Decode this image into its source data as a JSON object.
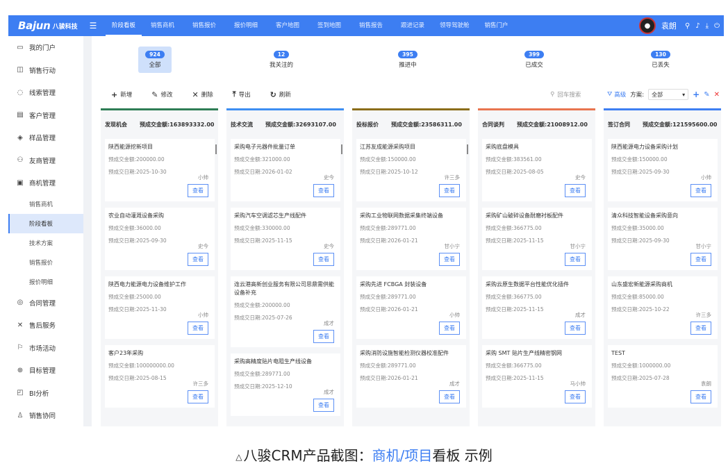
{
  "topbar": {
    "logo": "Bajun",
    "logo_cn": "八骏科技",
    "navs": [
      "阶段看板",
      "销售商机",
      "销售报价",
      "报价明细",
      "客户地图",
      "签到地图",
      "销售报告",
      "跟进记录",
      "领导驾驶舱",
      "销售门户"
    ],
    "active_nav": 0,
    "user": "袁朗"
  },
  "sidebar": {
    "items": [
      {
        "icon": "▭",
        "label": "我的门户"
      },
      {
        "icon": "◫",
        "label": "销售行动"
      },
      {
        "icon": "◌",
        "label": "线索管理"
      },
      {
        "icon": "▤",
        "label": "客户管理"
      },
      {
        "icon": "◈",
        "label": "样品管理"
      },
      {
        "icon": "⚇",
        "label": "友商管理"
      },
      {
        "icon": "▣",
        "label": "商机管理"
      }
    ],
    "subitems": [
      "销售商机",
      "阶段看板",
      "技术方案",
      "销售报价",
      "报价明细"
    ],
    "active_sub": 1,
    "items2": [
      {
        "icon": "◎",
        "label": "合同管理"
      },
      {
        "icon": "✕",
        "label": "售后服务"
      },
      {
        "icon": "⚐",
        "label": "市场活动"
      },
      {
        "icon": "⊕",
        "label": "目标管理"
      },
      {
        "icon": "◰",
        "label": "BI分析"
      },
      {
        "icon": "♙",
        "label": "销售协同"
      }
    ]
  },
  "stats": [
    {
      "count": "924",
      "label": "全部"
    },
    {
      "count": "12",
      "label": "我关注的"
    },
    {
      "count": "395",
      "label": "推进中"
    },
    {
      "count": "399",
      "label": "已成交"
    },
    {
      "count": "130",
      "label": "已丢失"
    }
  ],
  "toolbar": {
    "buttons": [
      {
        "icon": "+",
        "label": "新增"
      },
      {
        "icon": "✎",
        "label": "修改"
      },
      {
        "icon": "✕",
        "label": "删除"
      },
      {
        "icon": "⤒",
        "label": "导出"
      },
      {
        "icon": "↻",
        "label": "刷新"
      }
    ],
    "search_placeholder": "回车搜索",
    "advanced": "高级",
    "scheme_label": "方案:",
    "scheme_value": "全部"
  },
  "columns": [
    {
      "stage": "发现机会",
      "amount_label": "预成交金额:",
      "amount": "163893332.00",
      "color": "#2e7d55",
      "cards": [
        {
          "title": "陕西能源挖新项目",
          "amount": "预成交金额:200000.00",
          "date": "预成交日期:2025-10-30",
          "owner": "小帅"
        },
        {
          "title": "农业自动灌溉设备采购",
          "amount": "预成交金额:36000.00",
          "date": "预成交日期:2025-09-30",
          "owner": "史今"
        },
        {
          "title": "陕西电力能源电力设备维护工作",
          "amount": "预成交金额:25000.00",
          "date": "预成交日期:2025-11-30",
          "owner": "小帅"
        },
        {
          "title": "客户23年采购",
          "amount": "预成交金额:100000000.00",
          "date": "预成交日期:2025-08-15",
          "owner": "许三多"
        }
      ]
    },
    {
      "stage": "技术交流",
      "amount_label": "预成交金额:",
      "amount": "32693107.00",
      "color": "#3d8ef2",
      "cards": [
        {
          "title": "采购电子元器件批量订单",
          "amount": "预成交金额:321000.00",
          "date": "预成交日期:2026-01-02",
          "owner": "史今"
        },
        {
          "title": "采购汽车空调滤芯生产线配件",
          "amount": "预成交金额:330000.00",
          "date": "预成交日期:2025-11-15",
          "owner": "史今"
        },
        {
          "title": "连云港高新创业服务有限公司思鼎需供能设备补充",
          "amount": "预成交金额:200000.00",
          "date": "预成交日期:2025-07-26",
          "owner": "成才"
        },
        {
          "title": "采购高精度贴片电阻生产线设备",
          "amount": "预成交金额:289771.00",
          "date": "预成交日期:2025-12-10",
          "owner": "成才"
        }
      ]
    },
    {
      "stage": "投标报价",
      "amount_label": "预成交金额:",
      "amount": "23586311.00",
      "color": "#8a6d1a",
      "cards": [
        {
          "title": "江苏友成能源采购项目",
          "amount": "预成交金额:150000.00",
          "date": "预成交日期:2025-10-12",
          "owner": "许三多"
        },
        {
          "title": "采购工业物联网数据采集终端设备",
          "amount": "预成交金额:289771.00",
          "date": "预成交日期:2026-01-21",
          "owner": "甘小宁"
        },
        {
          "title": "采购先进 FCBGA 封装设备",
          "amount": "预成交金额:289771.00",
          "date": "预成交日期:2026-01-21",
          "owner": "小帅"
        },
        {
          "title": "采购消防设施智能检测仪器校准配件",
          "amount": "预成交金额:289771.00",
          "date": "预成交日期:2026-01-21",
          "owner": "成才"
        }
      ]
    },
    {
      "stage": "合同谈判",
      "amount_label": "预成交金额:",
      "amount": "21008912.00",
      "color": "#e8744f",
      "cards": [
        {
          "title": "采购底盘模具",
          "amount": "预成交金额:383561.00",
          "date": "预成交日期:2025-08-05",
          "owner": "史今"
        },
        {
          "title": "采购矿山破碎设备耐磨衬板配件",
          "amount": "预成交金额:366775.00",
          "date": "预成交日期:2025-11-15",
          "owner": "甘小宁"
        },
        {
          "title": "采购云原生数据平台性能优化插件",
          "amount": "预成交金额:366775.00",
          "date": "预成交日期:2025-11-15",
          "owner": "成才"
        },
        {
          "title": "采购 SMT 贴片生产线精密钢网",
          "amount": "预成交金额:366775.00",
          "date": "预成交日期:2025-11-15",
          "owner": "马小帅"
        }
      ]
    },
    {
      "stage": "签订合同",
      "amount_label": "预成交金额:",
      "amount": "121595600.00",
      "color": "#3d7ef2",
      "cards": [
        {
          "title": "陕西能源电力设备采购计划",
          "amount": "预成交金额:150000.00",
          "date": "预成交日期:2025-09-30",
          "owner": "小帅"
        },
        {
          "title": "清众科技智能设备采购意向",
          "amount": "预成交金额:35000.00",
          "date": "预成交日期:2025-09-30",
          "owner": "甘小宁"
        },
        {
          "title": "山东盛宏新能源采购商机",
          "amount": "预成交金额:85000.00",
          "date": "预成交日期:2025-10-22",
          "owner": "许三多"
        },
        {
          "title": "TEST",
          "amount": "预成交金额:1000000.00",
          "date": "预成交日期:2025-07-28",
          "owner": "袁朗"
        }
      ]
    }
  ],
  "view_label": "查看",
  "caption": {
    "pre": "八骏CRM产品截图：",
    "link": "商机/项目",
    "post": "看板 示例"
  }
}
